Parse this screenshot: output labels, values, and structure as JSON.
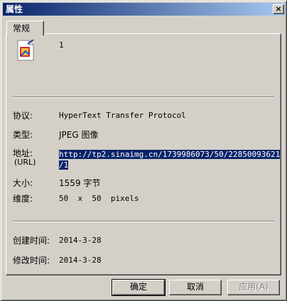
{
  "window": {
    "title": "属性",
    "close_glyph": "×"
  },
  "tabs": [
    {
      "label": "常规"
    }
  ],
  "file": {
    "icon": "image-file-icon",
    "name": "1"
  },
  "properties": {
    "protocol_label": "协议:",
    "protocol_value": "HyperText Transfer Protocol",
    "type_label": "类型:",
    "type_value": "JPEG 图像",
    "address_label": "地址:",
    "address_sub_label": "(URL)",
    "address_line1": "http://tp2.sinaimg.cn/1739986073/50/22850093621",
    "address_line2": "/1",
    "size_label": "大小:",
    "size_value": "1559 字节",
    "dimension_label": "维度:",
    "dimension_value": "50  x  50  pixels"
  },
  "dates": {
    "created_label": "创建时间:",
    "created_value": "2014-3-28",
    "modified_label": "修改时间:",
    "modified_value": "2014-3-28"
  },
  "buttons": {
    "ok": "确定",
    "cancel": "取消",
    "apply": "应用(A)"
  }
}
